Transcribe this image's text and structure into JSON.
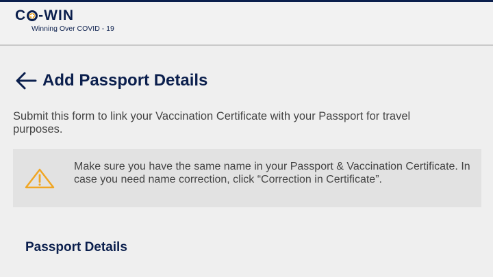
{
  "app": {
    "logo_text_c": "C",
    "logo_text_win": "-WIN",
    "logo_tagline": "Winning Over COVID - 19"
  },
  "page": {
    "title": "Add Passport Details",
    "description": "Submit this form to link your Vaccination Certificate with your Passport for travel purposes."
  },
  "notice": {
    "icon": "warning-icon",
    "text": "Make sure you have the same name in your Passport & Vaccination Certificate. In case you need name correction, click “Correction in Certificate”."
  },
  "section": {
    "title": "Passport Details"
  },
  "colors": {
    "brand_navy": "#0b1f4d",
    "warning_yellow": "#f0a623",
    "background": "#efefef",
    "notice_background": "#e2e2e2"
  }
}
